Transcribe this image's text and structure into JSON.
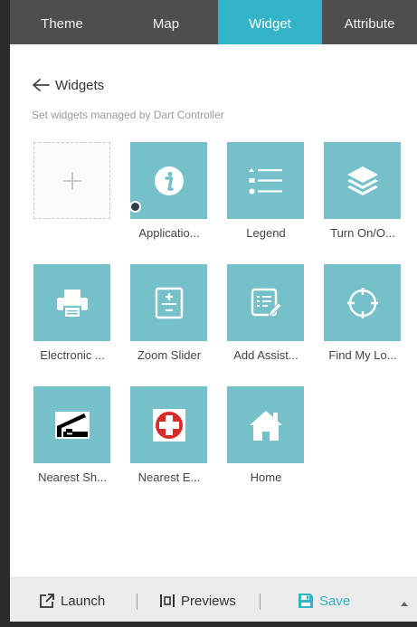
{
  "tabs": [
    {
      "label": "Theme",
      "active": false
    },
    {
      "label": "Map",
      "active": false
    },
    {
      "label": "Widget",
      "active": true
    },
    {
      "label": "Attribute",
      "active": false
    }
  ],
  "header": {
    "back_label": "Widgets",
    "subtitle": "Set widgets managed by Dart Controller"
  },
  "widgets": [
    {
      "label": "",
      "icon": "plus-icon",
      "kind": "add"
    },
    {
      "label": "Applicatio...",
      "icon": "info-icon",
      "indicator": true
    },
    {
      "label": "Legend",
      "icon": "list-icon"
    },
    {
      "label": "Turn On/O...",
      "icon": "layers-icon"
    },
    {
      "label": "Electronic ...",
      "icon": "printer-icon"
    },
    {
      "label": "Zoom Slider",
      "icon": "zoom-slider-icon"
    },
    {
      "label": "Add Assist...",
      "icon": "edit-list-icon"
    },
    {
      "label": "Find My Lo...",
      "icon": "crosshair-icon"
    },
    {
      "label": "Nearest Sh...",
      "icon": "shelter-icon"
    },
    {
      "label": "Nearest E...",
      "icon": "red-cross-icon"
    },
    {
      "label": "Home",
      "icon": "home-icon"
    }
  ],
  "footer": {
    "launch": "Launch",
    "previews": "Previews",
    "save": "Save"
  },
  "colors": {
    "accent": "#34b4c9",
    "tile": "#76c1c9",
    "tabbar": "#4e4e4e",
    "footer": "#ececec"
  }
}
